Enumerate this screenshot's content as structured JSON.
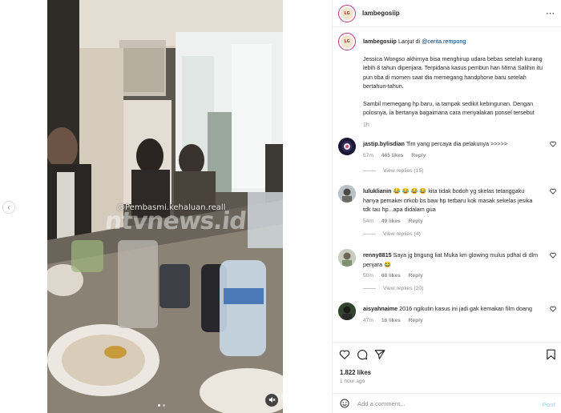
{
  "post": {
    "username": "lambegosiip",
    "more_icon": "ellipsis-icon",
    "avatar_text": "LG"
  },
  "caption": {
    "username": "lambegosiip",
    "lead": "Lanjut di",
    "mention": "@cerita.rempong",
    "paragraph1": "Jessica Wongso akhirnya bisa menghirup udara bebas setelah kurang lebih 8 tahun dipenjara. Terpidana kasus pembun han Mirna Salihin itu pun tiba di momen saat dia memegang handphone baru setelah bertahun-tahun.",
    "paragraph2": "Sambil memegang hp baru, ia tampak sedikit kebingunan. Dengan polosnya, ia bertanya bagaimana cara menyalakan ponsel tersebut",
    "time": "1h"
  },
  "media": {
    "watermark_handle": "@Pembasmi.kehaluan.reall",
    "watermark_brand": "ntvnews.id",
    "watermark_brand2": "Int",
    "dots": 2,
    "active_dot": 0,
    "mute_icon": "speaker-muted-icon"
  },
  "comments": [
    {
      "username": "jastip.bylisdian",
      "text": "Tim yang percaya dia pelakunya >>>>>",
      "time": "57m",
      "likes": "465 likes",
      "reply": "Reply",
      "view_replies": "View replies (15)"
    },
    {
      "username": "luluklianin",
      "text": "😂 😂 😂 😂 kita tidak bodoh yg skelas tetanggaku hanya pemakei nrkob bs baw hp terbaru kok masak sekelas jesika tdk tau hp...apa didalam gua",
      "time": "54m",
      "likes": "49 likes",
      "reply": "Reply",
      "view_replies": "View replies (4)"
    },
    {
      "username": "renny8815",
      "text": "Saya jg bngung liat Muka km glowing mulus pdhal di dlm penjara 😂",
      "time": "50m",
      "likes": "68 likes",
      "reply": "Reply",
      "view_replies": "View replies (20)"
    },
    {
      "username": "aisyahnaime",
      "text": "2016 ngikutin kasus ini jadi gak kemakan film doang",
      "time": "47m",
      "likes": "16 likes",
      "reply": "Reply"
    }
  ],
  "actions": {
    "likes": "1.822 likes",
    "ago": "1 hour ago",
    "comment_placeholder": "Add a comment...",
    "post_label": "Post",
    "icons": [
      "heart-icon",
      "comment-icon",
      "share-icon",
      "bookmark-icon"
    ]
  },
  "colors": {
    "accent_link": "#00376b",
    "post_disabled": "#b2dffc",
    "muted_text": "#8e8e8e",
    "avatar_ring": "#c13584"
  }
}
